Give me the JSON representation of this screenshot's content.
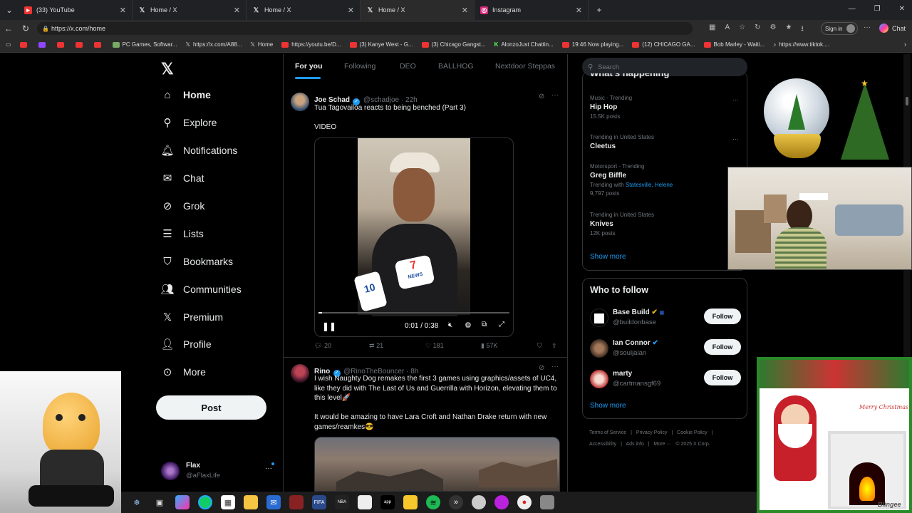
{
  "browser": {
    "tabs": [
      {
        "label": "(33) YouTube",
        "icon": "youtube-icon"
      },
      {
        "label": "Home / X",
        "icon": "x-icon"
      },
      {
        "label": "Home / X",
        "icon": "x-icon"
      },
      {
        "label": "Home / X",
        "icon": "x-icon"
      },
      {
        "label": "Instagram",
        "icon": "instagram-icon"
      }
    ],
    "url": "https://x.com/home",
    "signin_label": "Sign in",
    "chat_label": "Chat",
    "bookmarks": [
      "PC Games, Softwar...",
      "https://x.com/A88...",
      "Home",
      "https://youtu.be/D...",
      "(3) Kanye West - G...",
      "(3) Chicago Gangst...",
      "AlonzoJust Chattin...",
      "19:46 Now playing...",
      "(12) CHICAGO GA...",
      "Bob Marley - Waiti...",
      "https://www.tiktok...."
    ]
  },
  "nav": {
    "items": [
      "Home",
      "Explore",
      "Notifications",
      "Chat",
      "Grok",
      "Lists",
      "Bookmarks",
      "Communities",
      "Premium",
      "Profile",
      "More"
    ],
    "post_label": "Post",
    "user": {
      "name": "Flax",
      "handle": "@aFlaxLife"
    }
  },
  "feed": {
    "tabs": [
      "For you",
      "Following",
      "DEO",
      "BALLHOG",
      "Nextdoor Steppas"
    ],
    "tweets": [
      {
        "name": "Joe Schad",
        "handle": "@schadjoe",
        "time": "22h",
        "text": "Tua Tagovailoa reacts to being benched (Part 3)",
        "label": "VIDEO",
        "video_time": "0:01 / 0:38",
        "replies": "20",
        "retweets": "21",
        "likes": "181",
        "views": "57K"
      },
      {
        "name": "Rino",
        "handle": "@RinoTheBouncer",
        "time": "8h",
        "text1": "I wish Naughty Dog remakes the first 3 games using graphics/assets of UC4, like they did with The Last of Us and Guerrilla with Horizon, elevating them to this level🚀",
        "text2": "It would be amazing to have Lara Croft and Nathan Drake return with new games/reamkes😎"
      }
    ]
  },
  "search": {
    "placeholder": "Search"
  },
  "trends": {
    "header": "What's happening",
    "items": [
      {
        "category": "Music · Trending",
        "name": "Hip Hop",
        "posts": "15.5K posts"
      },
      {
        "category": "Trending in United States",
        "name": "Cleetus",
        "posts": ""
      },
      {
        "category": "Motorsport · Trending",
        "name": "Greg Biffle",
        "with_label": "Trending with",
        "with_links": "Statesville, Helene",
        "posts": "9,797 posts"
      },
      {
        "category": "Trending in United States",
        "name": "Knives",
        "posts": "12K posts"
      }
    ],
    "show_more": "Show more"
  },
  "who_to_follow": {
    "title": "Who to follow",
    "items": [
      {
        "name": "Base Build",
        "handle": "@buildonbase"
      },
      {
        "name": "Ian Connor",
        "handle": "@souljalan"
      },
      {
        "name": "marty",
        "handle": "@cartmansgf69"
      }
    ],
    "follow_label": "Follow",
    "show_more": "Show more"
  },
  "footer": {
    "links": [
      "Terms of Service",
      "Privacy Policy",
      "Cookie Policy",
      "Accessibility",
      "Ads info",
      "More ···",
      "© 2025 X Corp."
    ]
  },
  "overlay": {
    "christmas_text": "Merry Christmas",
    "blingee": "Blingee"
  },
  "colors": {
    "accent": "#1d9bf0",
    "bg": "#000000",
    "text": "#e7e9ea",
    "muted": "#71767b"
  }
}
